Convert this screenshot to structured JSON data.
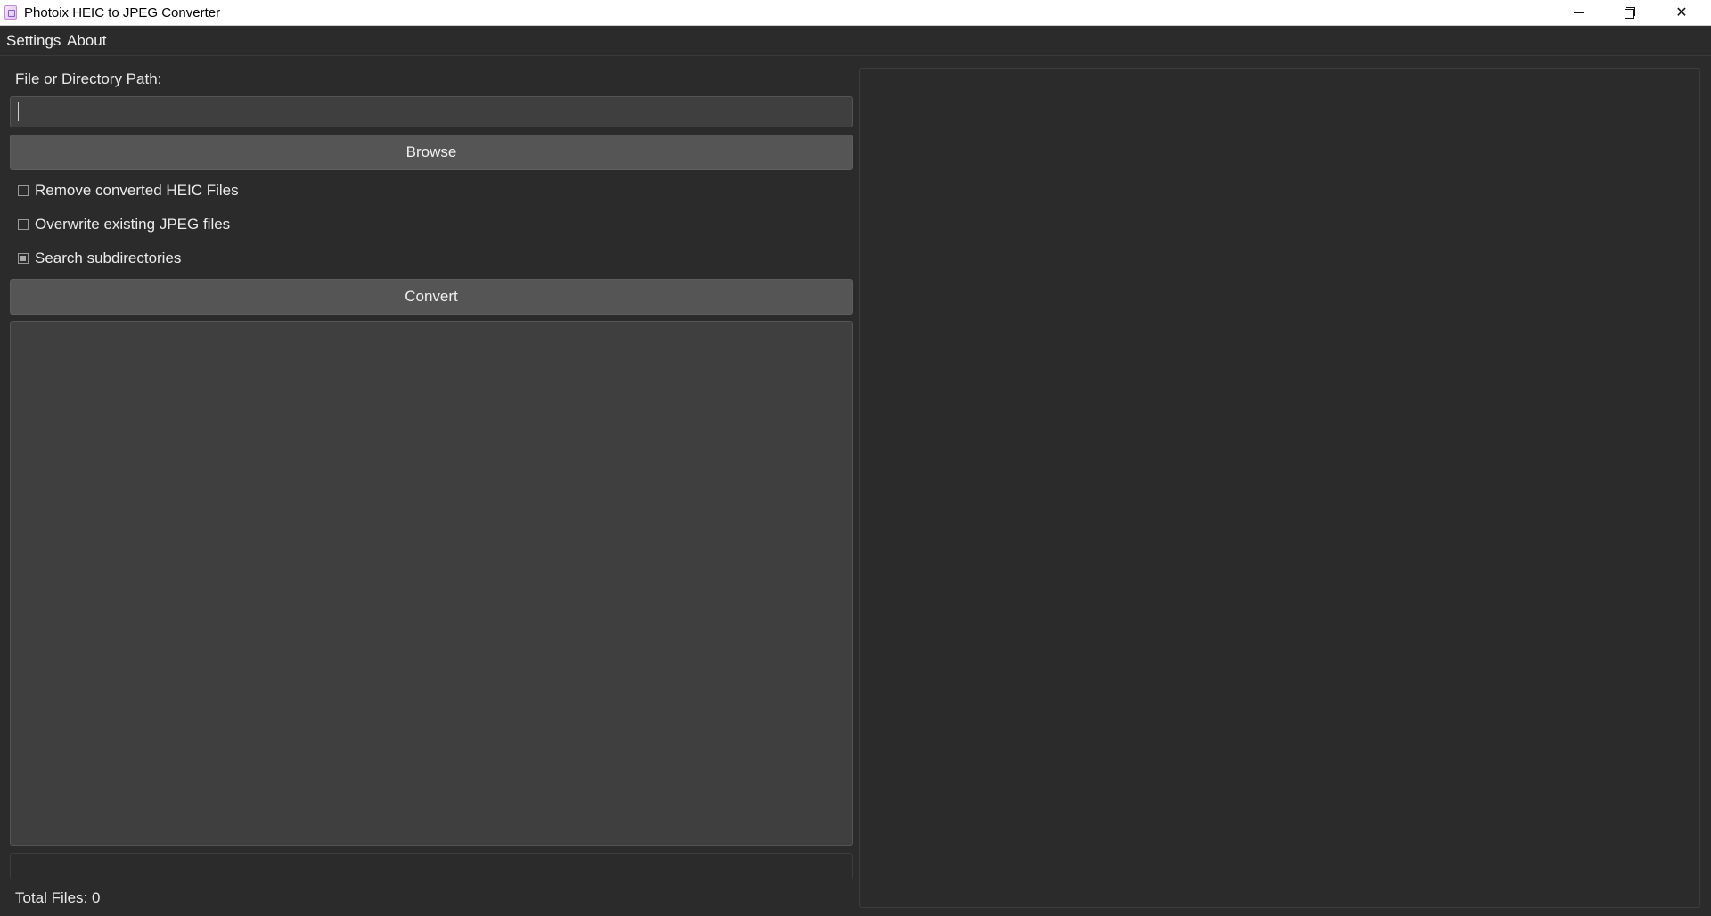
{
  "window": {
    "title": "Photoix HEIC to JPEG Converter",
    "icons": {
      "app": "app-icon",
      "minimize": "minimize-icon",
      "maximize": "restore-icon",
      "close": "close-icon",
      "close_glyph": "✕"
    }
  },
  "menu": {
    "items": [
      {
        "label": "Settings"
      },
      {
        "label": "About"
      }
    ]
  },
  "form": {
    "path_label": "File or Directory Path:",
    "path_value": "",
    "path_placeholder": "",
    "browse_label": "Browse",
    "options": [
      {
        "label": "Remove converted HEIC Files",
        "checked": false
      },
      {
        "label": "Overwrite existing JPEG files",
        "checked": false
      },
      {
        "label": "Search subdirectories",
        "checked": true
      }
    ],
    "convert_label": "Convert"
  },
  "status": {
    "total_files": "Total Files: 0"
  },
  "colors": {
    "background": "#2b2b2b",
    "input_bg": "#3f3f3f",
    "button_bg": "#555555",
    "text": "#e8e8e8"
  }
}
